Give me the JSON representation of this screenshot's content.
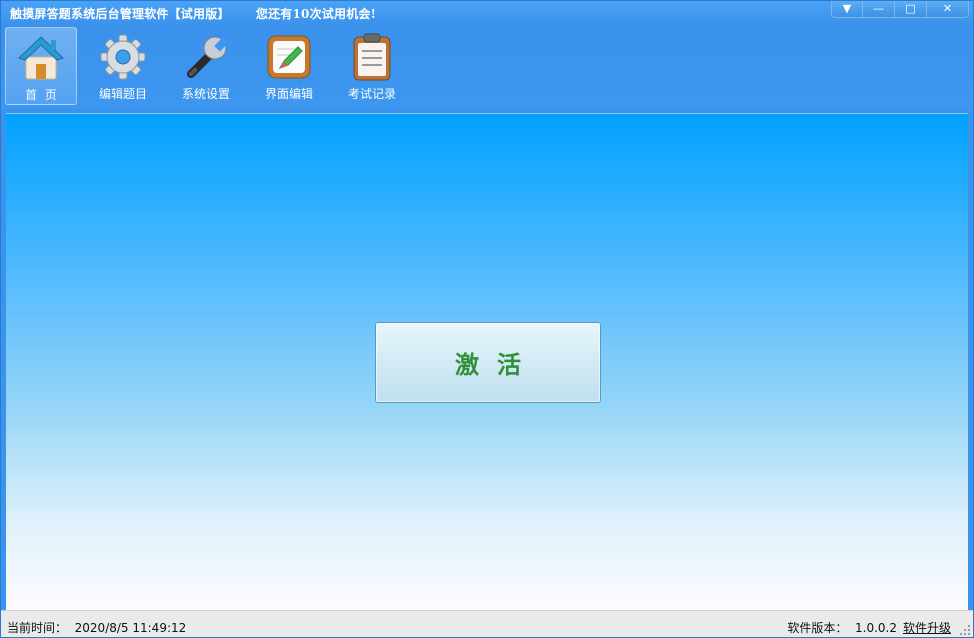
{
  "window": {
    "title": "触摸屏答题系统后台管理软件【试用版】",
    "trial_notice": "您还有10次试用机会!",
    "controls": {
      "menu": "▼",
      "minimize": "—",
      "maximize": "□",
      "close": "✕"
    }
  },
  "toolbar": {
    "items": [
      {
        "label": "首  页",
        "icon": "home-icon",
        "active": true
      },
      {
        "label": "编辑题目",
        "icon": "gear-icon",
        "active": false
      },
      {
        "label": "系统设置",
        "icon": "wrench-icon",
        "active": false
      },
      {
        "label": "界面编辑",
        "icon": "edit-board-icon",
        "active": false
      },
      {
        "label": "考试记录",
        "icon": "clipboard-icon",
        "active": false
      }
    ]
  },
  "main": {
    "activate_label": "激活"
  },
  "status": {
    "time_label": "当前时间：",
    "time_value": "2020/8/5 11:49:12",
    "version_label": "软件版本：",
    "version_value": "1.0.0.2",
    "upgrade_link": "软件升级"
  },
  "colors": {
    "titlebar": "#3a92ec",
    "main_top": "#00a2ff",
    "main_bottom": "#fdfbff",
    "activate_text": "#2f8f3a"
  }
}
